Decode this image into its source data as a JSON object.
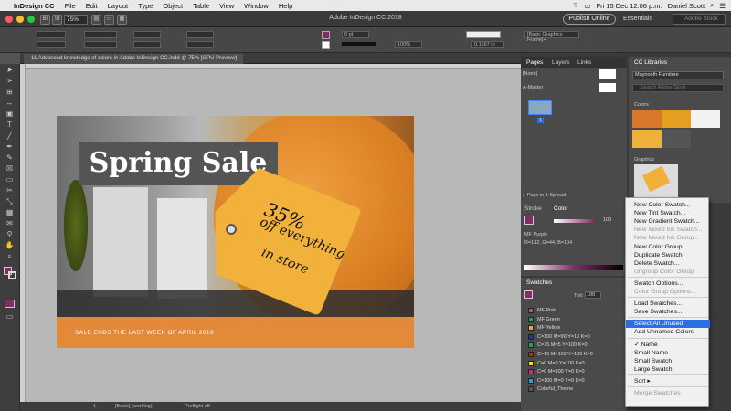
{
  "menubar": {
    "app": "InDesign CC",
    "items": [
      "File",
      "Edit",
      "Layout",
      "Type",
      "Object",
      "Table",
      "View",
      "Window",
      "Help"
    ],
    "datetime": "Fri 15 Dec 12:06 p.m.",
    "user": "Daniel Scott"
  },
  "window": {
    "title": "Adobe InDesign CC 2018",
    "zoom": "75%",
    "publish_label": "Publish Online",
    "workspace": "Essentials",
    "stock_placeholder": "Adobe Stock"
  },
  "control_bar": {
    "stroke_weight": "0 pt",
    "opacity": "100%",
    "gap": "0.1667 in",
    "frame_style": "[Basic Graphics Frame]+"
  },
  "document_tab": "11 Advanced knowledge of colors in Adobe InDesign CC.indd @ 75% [GPU Preview]",
  "artwork": {
    "title": "Spring Sale",
    "tag_percent": "35%",
    "tag_line1": "off everything",
    "tag_line2": "in store",
    "footer_text": "SALE ENDS THE LAST WEEK OF APRIL 2019"
  },
  "status_bar": {
    "page": "1",
    "style": "[Basic] (working)",
    "preflight": "Preflight off"
  },
  "pages_panel": {
    "tabs": [
      "Pages",
      "Layers",
      "Links"
    ],
    "none_label": "[None]",
    "master_label": "A-Master",
    "page_num": "1",
    "footer": "1 Page in 1 Spread"
  },
  "color_panel": {
    "tabs": [
      "Stroke",
      "Color"
    ],
    "tint": "100",
    "swatch_name": "MF Purple",
    "values": "R=132, G=44, B=104"
  },
  "swatches_panel": {
    "title": "Swatches",
    "tint_label": "Tint:",
    "tint_value": "100",
    "items": [
      {
        "name": "MF Pink",
        "color": "#c04a6a"
      },
      {
        "name": "MF Green",
        "color": "#3a9a4a"
      },
      {
        "name": "MF Yellow",
        "color": "#e0b020"
      },
      {
        "name": "C=100 M=90 Y=10 K=0",
        "color": "#203a90"
      },
      {
        "name": "C=75 M=5 Y=100 K=0",
        "color": "#30a040"
      },
      {
        "name": "C=15 M=100 Y=100 K=0",
        "color": "#d02020"
      },
      {
        "name": "C=0 M=0 Y=100 K=0",
        "color": "#f0e020"
      },
      {
        "name": "C=0 M=100 Y=0 K=0",
        "color": "#e0208a"
      },
      {
        "name": "C=100 M=0 Y=0 K=0",
        "color": "#20a0e0"
      },
      {
        "name": "Colorful_Theme",
        "color": "#555555"
      }
    ]
  },
  "cc_libraries": {
    "title": "CC Libraries",
    "library": "Maynooth Furniture",
    "search_placeholder": "Search Adobe Stock",
    "colors_label": "Colors",
    "graphics_label": "Graphics",
    "colors": [
      "#d9762a",
      "#e3a020",
      "#f2f2f2",
      "#f0b03a",
      "#555555"
    ]
  },
  "context_menu": {
    "items": [
      {
        "label": "New Color Swatch...",
        "disabled": false
      },
      {
        "label": "New Tint Swatch...",
        "disabled": false
      },
      {
        "label": "New Gradient Swatch...",
        "disabled": false
      },
      {
        "label": "New Mixed Ink Swatch...",
        "disabled": true
      },
      {
        "label": "New Mixed Ink Group...",
        "disabled": true
      },
      {
        "label": "New Color Group...",
        "disabled": false
      },
      {
        "label": "Duplicate Swatch",
        "disabled": false
      },
      {
        "label": "Delete Swatch...",
        "disabled": false
      },
      {
        "label": "Ungroup Color Group",
        "disabled": true
      },
      {
        "label": "Swatch Options...",
        "disabled": false
      },
      {
        "label": "Color Group Options...",
        "disabled": true
      },
      {
        "label": "Load Swatches...",
        "disabled": false
      },
      {
        "label": "Save Swatches...",
        "disabled": false
      },
      {
        "label": "Select All Unused",
        "disabled": false,
        "highlighted": true
      },
      {
        "label": "Add Unnamed Colors",
        "disabled": false
      },
      {
        "label": "Name",
        "disabled": false,
        "checked": true
      },
      {
        "label": "Small Name",
        "disabled": false
      },
      {
        "label": "Small Swatch",
        "disabled": false
      },
      {
        "label": "Large Swatch",
        "disabled": false
      },
      {
        "label": "Sort",
        "disabled": false,
        "submenu": true
      },
      {
        "label": "Merge Swatches",
        "disabled": true
      }
    ]
  }
}
